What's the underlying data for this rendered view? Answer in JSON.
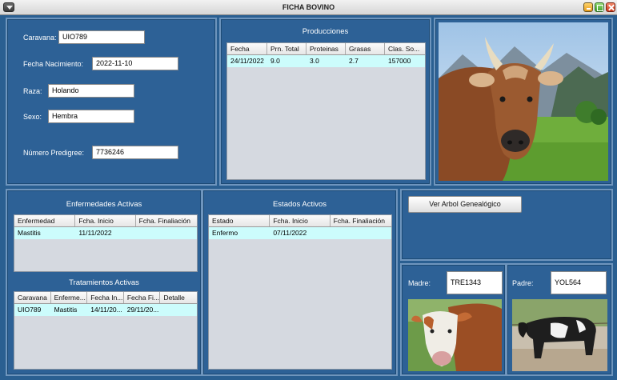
{
  "window": {
    "title": "FICHA BOVINO"
  },
  "ficha": {
    "caravana_label": "Caravana:",
    "caravana": "UIO789",
    "fecha_nac_label": "Fecha Nacimiento:",
    "fecha_nac": "2022-11-10",
    "raza_label": "Raza:",
    "raza": "Holando",
    "sexo_label": "Sexo:",
    "sexo": "Hembra",
    "predigree_label": "Número Predigree:",
    "predigree": "7736246"
  },
  "producciones": {
    "title": "Producciones",
    "columns": [
      "Fecha",
      "Prn. Total",
      "Proteinas",
      "Grasas",
      "Clas. So..."
    ],
    "rows": [
      [
        "24/11/2022",
        "9.0",
        "3.0",
        "2.7",
        "157000"
      ]
    ]
  },
  "enfermedades": {
    "title": "Enfermedades Activas",
    "columns": [
      "Enfermedad",
      "Fcha. Inicio",
      "Fcha. Finaliación"
    ],
    "rows": [
      [
        "Mastitis",
        "11/11/2022",
        ""
      ]
    ]
  },
  "tratamientos": {
    "title": "Tratamientos Activas",
    "columns": [
      "Caravana",
      "Enferme...",
      "Fecha In...",
      "Fecha Fi...",
      "Detalle"
    ],
    "rows": [
      [
        "UIO789",
        "Mastitis",
        "14/11/20...",
        "29/11/20...",
        ""
      ]
    ]
  },
  "estados": {
    "title": "Estados Activos",
    "columns": [
      "Estado",
      "Fcha. Inicio",
      "Fcha. Finaliación"
    ],
    "rows": [
      [
        "Enfermo",
        "07/11/2022",
        ""
      ]
    ]
  },
  "arbol_button": "Ver Arbol Genealógico",
  "padres": {
    "madre_label": "Madre:",
    "madre": "TRE1343",
    "padre_label": "Padre:",
    "padre": "YOL564"
  }
}
